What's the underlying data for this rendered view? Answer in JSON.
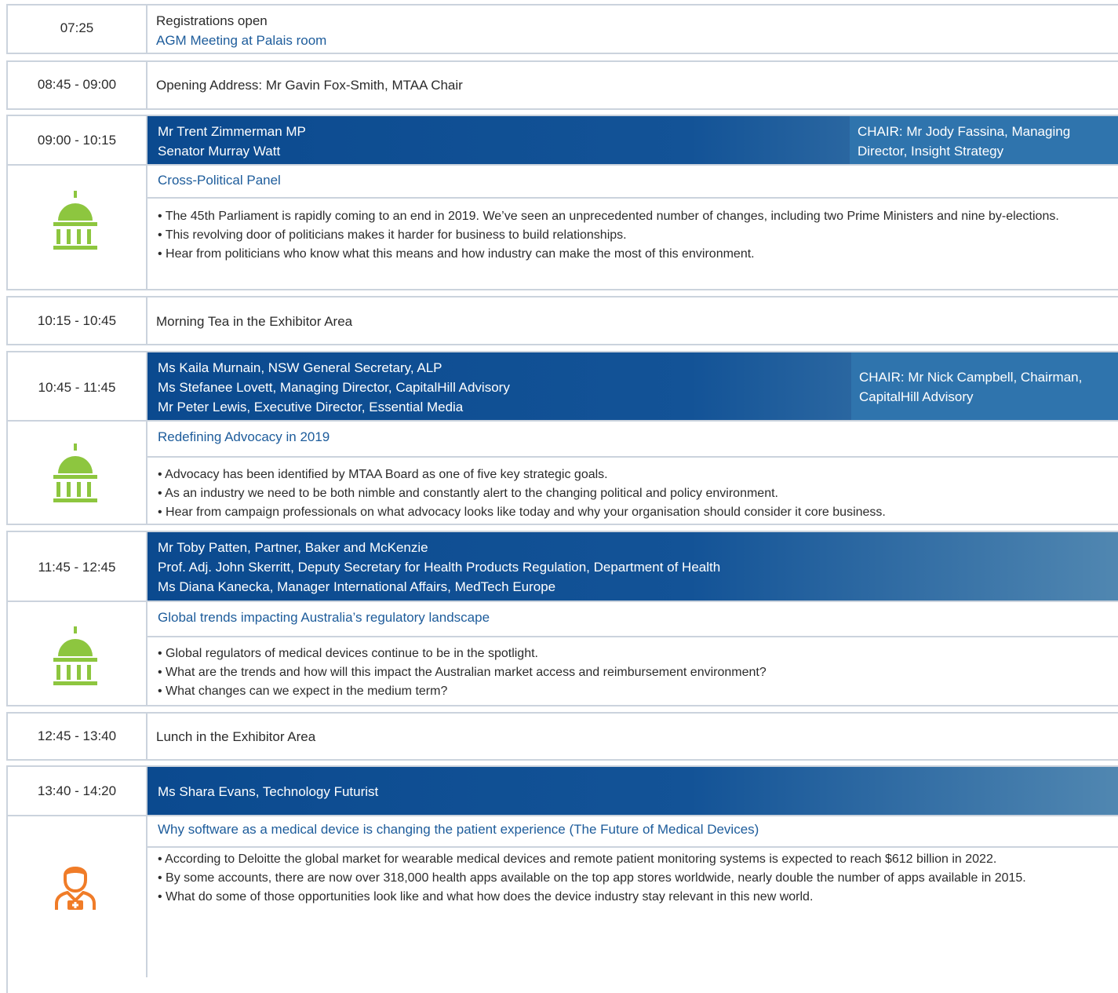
{
  "row1": {
    "time": "07:25",
    "line1": "Registrations open",
    "line2": "AGM Meeting at Palais room"
  },
  "row2": {
    "time": "08:45 - 09:00",
    "text": "Opening Address: Mr Gavin Fox-Smith, MTAA Chair"
  },
  "session1": {
    "time": "09:00 - 10:15",
    "speakers": [
      "Mr Trent Zimmerman MP",
      "Senator Murray Watt"
    ],
    "chair": [
      "CHAIR: Mr Jody Fassina, Managing",
      "Director, Insight Strategy"
    ],
    "title": "Cross-Political Panel",
    "icon": "parliament-icon",
    "bullets": [
      "• The 45th Parliament is rapidly coming to an end in 2019. We’ve seen an unprecedented number of changes, including two Prime Ministers and nine by-elections.",
      "• This revolving door of politicians makes it harder for business to build relationships.",
      "• Hear from politicians who know what this means and how industry can make the most of this environment."
    ]
  },
  "row4": {
    "time": "10:15 - 10:45",
    "text": "Morning Tea in the Exhibitor Area"
  },
  "session2": {
    "time": "10:45 - 11:45",
    "speakers": [
      "Ms Kaila Murnain, NSW General Secretary, ALP",
      "Ms Stefanee Lovett, Managing Director, CapitalHill Advisory",
      "Mr Peter Lewis, Executive Director, Essential Media"
    ],
    "chair": [
      "CHAIR: Mr Nick Campbell, Chairman,",
      "CapitalHill Advisory"
    ],
    "title": "Redefining Advocacy in 2019",
    "icon": "parliament-icon",
    "bullets": [
      "• Advocacy has been identified by MTAA Board as one of five key strategic goals.",
      "• As an industry we need to be both nimble and constantly alert to the changing political and policy environment.",
      "• Hear from campaign professionals on what advocacy looks like today and why your organisation should consider it core business."
    ]
  },
  "session3": {
    "time": "11:45 - 12:45",
    "speakers": [
      "Mr Toby Patten, Partner, Baker and McKenzie",
      "Prof. Adj. John Skerritt, Deputy Secretary for Health Products Regulation, Department of Health",
      "Ms Diana Kanecka, Manager International Affairs, MedTech Europe"
    ],
    "title": "Global trends impacting Australia’s regulatory landscape",
    "icon": "parliament-icon",
    "bullets": [
      "• Global regulators of medical devices continue to be in the spotlight.",
      "• What are the trends and how will this impact the Australian market access and reimbursement environment?",
      "• What changes can we expect in the medium term?"
    ]
  },
  "row7": {
    "time": "12:45 - 13:40",
    "text": "Lunch in the Exhibitor Area"
  },
  "session4": {
    "time": "13:40 - 14:20",
    "speakers": [
      "Ms Shara Evans, Technology Futurist"
    ],
    "title": "Why software as a medical device is changing the patient experience (The Future of Medical Devices)",
    "icon": "doctor-icon",
    "bullets": [
      "• According to Deloitte the global market for wearable medical devices and remote patient monitoring systems is expected to reach $612 billion in 2022.",
      "• By some accounts, there are now over 318,000 health apps available on the top app stores worldwide, nearly double the number of apps available in 2015.",
      "• What do some of those opportunities look like and what how does the device industry stay relevant in this new world."
    ]
  },
  "colors": {
    "green": "#8dc63f",
    "orange": "#f07c28",
    "blue": "#0b4a8f",
    "chair_blue": "#2f74ad",
    "link": "#1d5c9b"
  }
}
